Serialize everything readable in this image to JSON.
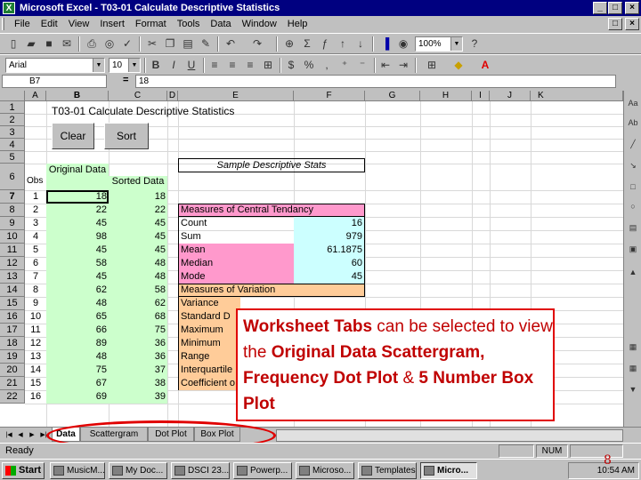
{
  "window": {
    "title": "Microsoft Excel - T03-01 Calculate Descriptive Statistics"
  },
  "menu": [
    "File",
    "Edit",
    "View",
    "Insert",
    "Format",
    "Tools",
    "Data",
    "Window",
    "Help"
  ],
  "toolbar": {
    "zoom": "100%",
    "font": "Arial",
    "size": "10"
  },
  "formula": {
    "cell": "B7",
    "eq": "=",
    "value": "18"
  },
  "columns": [
    "A",
    "B",
    "C",
    "D",
    "E",
    "F",
    "G",
    "H",
    "I",
    "J",
    "K"
  ],
  "rows": [
    "1",
    "2",
    "3",
    "4",
    "5",
    "6",
    "7",
    "8",
    "9",
    "10",
    "11",
    "12",
    "13",
    "14",
    "15",
    "16",
    "17",
    "18",
    "19",
    "20",
    "21",
    "22"
  ],
  "sheet": {
    "title": "T03-01 Calculate Descriptive Statistics",
    "clear": "Clear",
    "sort": "Sort",
    "sample_title": "Sample Descriptive Stats",
    "obs_header": "Obs",
    "orig_header": "Original Data",
    "sorted_header": "Sorted Data",
    "obs": [
      "1",
      "2",
      "3",
      "4",
      "5",
      "6",
      "7",
      "8",
      "9",
      "10",
      "11",
      "12",
      "13",
      "14",
      "15",
      "16"
    ],
    "original": [
      "18",
      "22",
      "45",
      "98",
      "45",
      "58",
      "45",
      "62",
      "48",
      "65",
      "66",
      "89",
      "48",
      "75",
      "67",
      "69"
    ],
    "sorted": [
      "18",
      "22",
      "45",
      "45",
      "45",
      "48",
      "48",
      "58",
      "62",
      "68",
      "75",
      "36",
      "36",
      "37",
      "38",
      "39"
    ],
    "central_title": "Measures of Central Tendancy",
    "central": [
      {
        "label": "Count",
        "value": "16"
      },
      {
        "label": "Sum",
        "value": "979"
      },
      {
        "label": "Mean",
        "value": "61.1875"
      },
      {
        "label": "Median",
        "value": "60"
      },
      {
        "label": "Mode",
        "value": "45"
      }
    ],
    "variation_title": "Measures of Variation",
    "variation": [
      "Variance",
      "Standard D",
      "Maximum",
      "Minimum",
      "Range",
      "Interquartile",
      "Coefficient o"
    ]
  },
  "callout": {
    "bold1": "Worksheet Tabs",
    "t1": " can be selected to view the ",
    "bold2": "Original Data Scattergram,  Frequency Dot Plot",
    "t2": " & ",
    "bold3": "5 Number Box Plot"
  },
  "tabs": [
    "Data",
    "Scattergram",
    "Dot Plot",
    "Box Plot"
  ],
  "status": {
    "text": "Ready",
    "num": "NUM"
  },
  "taskbar": {
    "start": "Start",
    "tasks": [
      "MusicM...",
      "My Doc...",
      "DSCI 23...",
      "Powerp...",
      "Microso...",
      "Templates",
      "Micro..."
    ],
    "clock": "10:54 AM"
  },
  "page_number": "8"
}
